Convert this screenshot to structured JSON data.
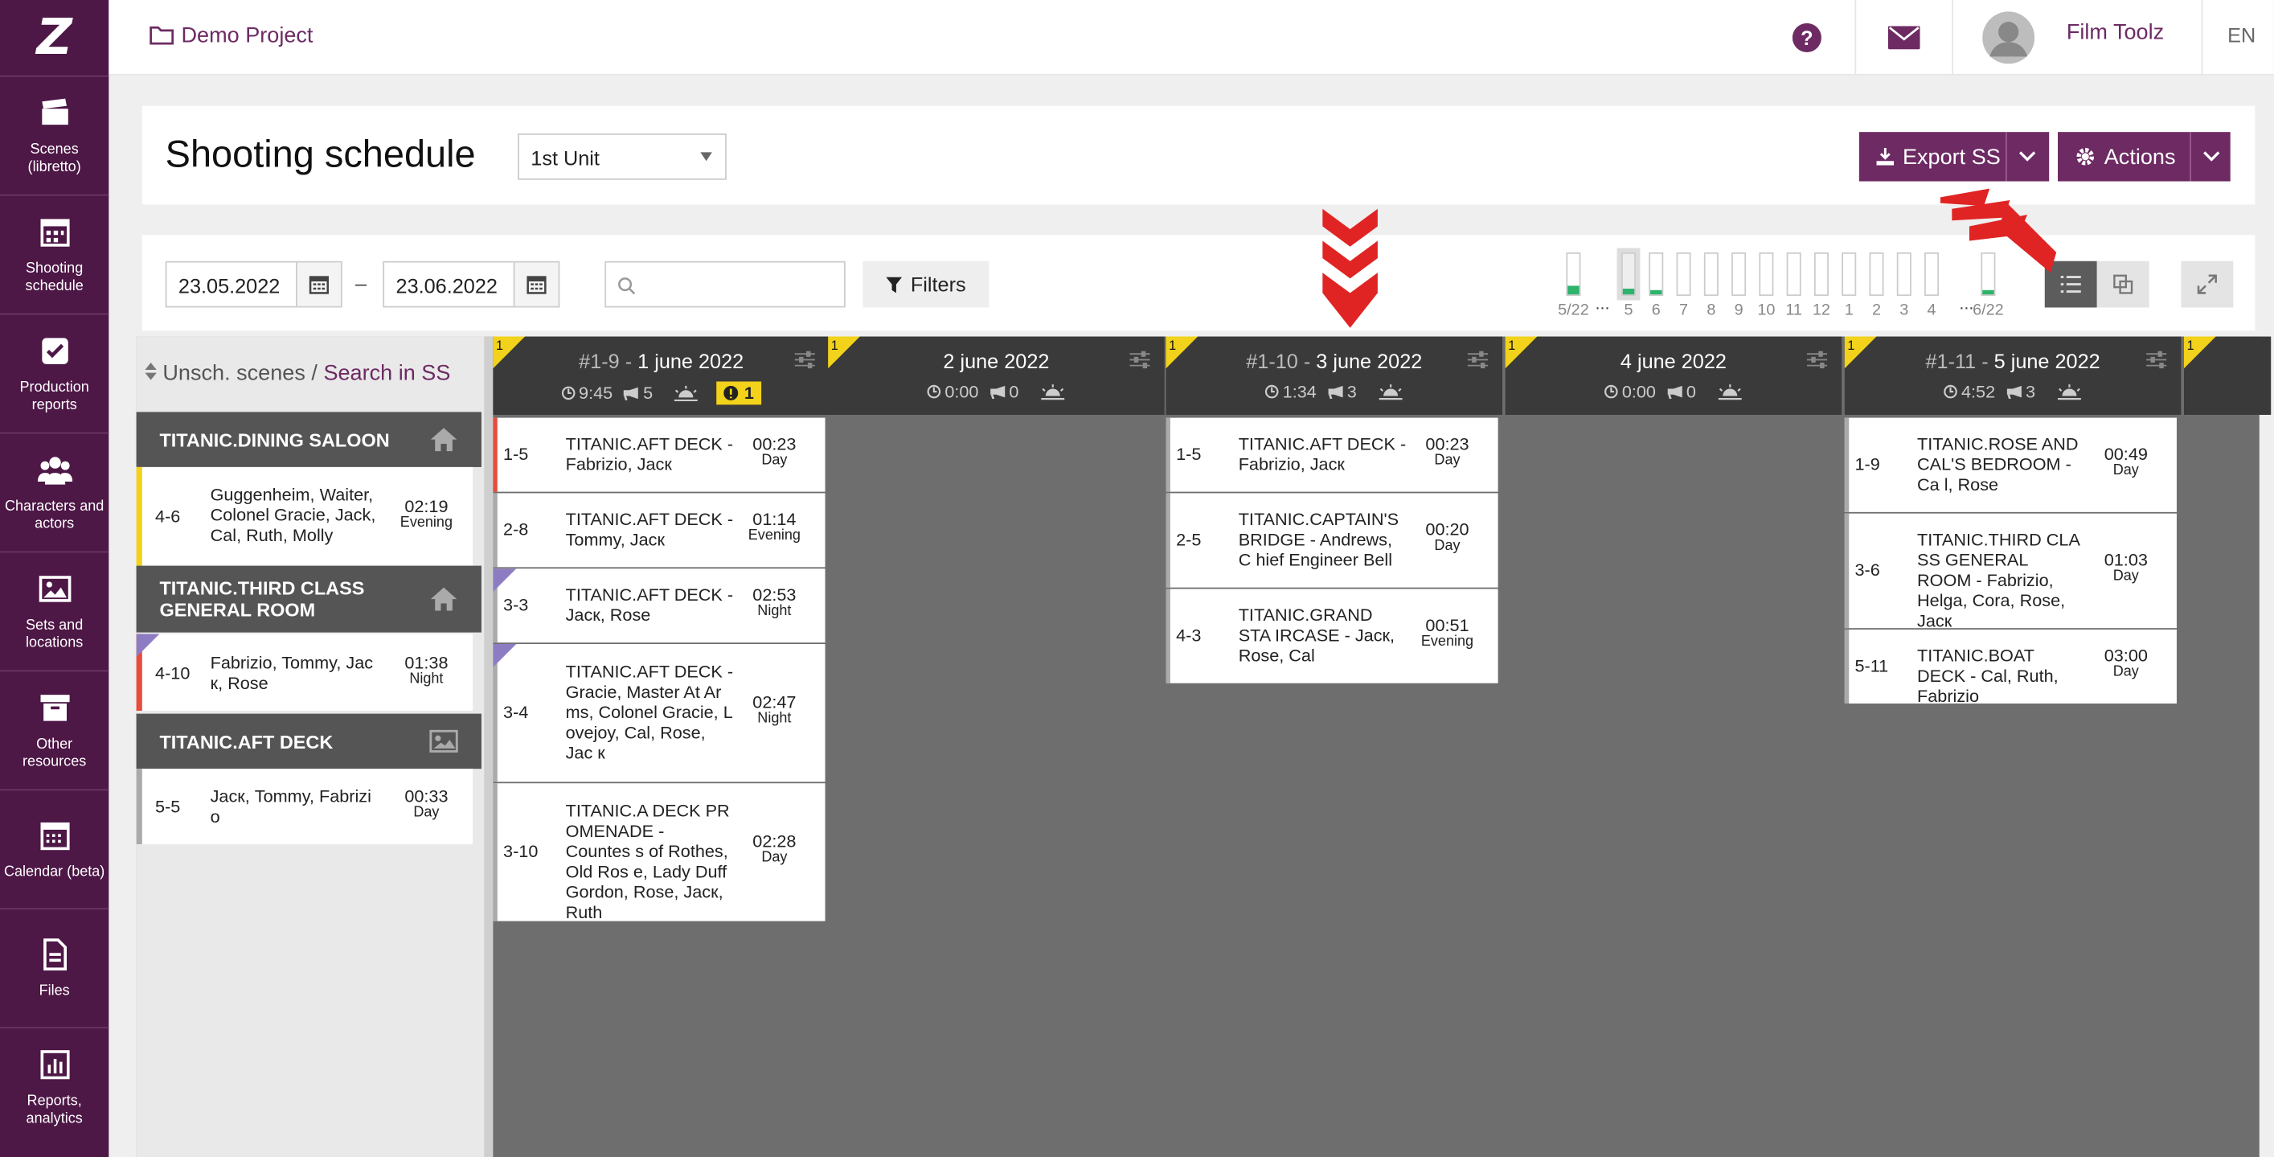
{
  "sidebar": {
    "items": [
      {
        "label": "Scenes (libretto)",
        "icon": "clapperboard-icon"
      },
      {
        "label": "Shooting schedule",
        "icon": "calendar-icon"
      },
      {
        "label": "Production reports",
        "icon": "checkbox-icon"
      },
      {
        "label": "Characters and actors",
        "icon": "users-icon"
      },
      {
        "label": "Sets and locations",
        "icon": "image-icon"
      },
      {
        "label": "Other resources",
        "icon": "archive-box-icon"
      },
      {
        "label": "Calendar (beta)",
        "icon": "calendar-grid-icon"
      },
      {
        "label": "Files",
        "icon": "file-icon"
      },
      {
        "label": "Reports, analytics",
        "icon": "bar-chart-icon"
      }
    ]
  },
  "topbar": {
    "project": "Demo Project",
    "user_name": "Film Toolz",
    "lang": "EN"
  },
  "header": {
    "title": "Shooting schedule",
    "unit": "1st Unit",
    "export_label": "Export SS",
    "actions_label": "Actions"
  },
  "toolbar": {
    "date_from": "23.05.2022",
    "date_to": "23.06.2022",
    "filters_label": "Filters",
    "bars": [
      {
        "label": "5/22",
        "fill": 0.2
      },
      {
        "label": "5",
        "fill": 0.15
      },
      {
        "label": "6",
        "fill": 0.12
      },
      {
        "label": "7",
        "fill": 0
      },
      {
        "label": "8",
        "fill": 0
      },
      {
        "label": "9",
        "fill": 0
      },
      {
        "label": "10",
        "fill": 0
      },
      {
        "label": "11",
        "fill": 0
      },
      {
        "label": "12",
        "fill": 0
      },
      {
        "label": "1",
        "fill": 0
      },
      {
        "label": "2",
        "fill": 0
      },
      {
        "label": "3",
        "fill": 0
      },
      {
        "label": "4",
        "fill": 0
      },
      {
        "label": "6/22",
        "fill": 0.12
      }
    ],
    "ellipsis": "..."
  },
  "left_panel": {
    "unsch_label": "Unsch. scenes",
    "slash": "/",
    "search_link": "Search in SS",
    "groups": [
      {
        "title": "TITANIC.DINING SALOON",
        "scenes": [
          {
            "num": "4-6",
            "desc": "Guggenheim, Waiter, Colonel Gracie, Jack, Cal, Ruth, Molly",
            "time": "02:19",
            "daypart": "Evening"
          }
        ]
      },
      {
        "title": "TITANIC.THIRD CLASS GENERAL ROOM",
        "scenes": [
          {
            "num": "4-10",
            "desc": "Fabrizio, Tommy, Jac к, Rose",
            "time": "01:38",
            "daypart": "Night"
          }
        ]
      },
      {
        "title": "TITANIC.AFT DECK",
        "scenes": [
          {
            "num": "5-5",
            "desc": "Jacк, Tommy, Fabrizi o",
            "time": "00:33",
            "daypart": "Day"
          }
        ]
      }
    ]
  },
  "days": [
    {
      "prefix": "#1-9 -",
      "date": "1 june 2022",
      "duration": "9:45",
      "scenes_count": "5",
      "warning": "1",
      "corner": "1",
      "scenes": [
        {
          "num": "1-5",
          "desc": "TITANIC.AFT DECK - Fabrizio, Jacк",
          "time": "00:23",
          "daypart": "Day"
        },
        {
          "num": "2-8",
          "desc": "TITANIC.AFT DECK - Tommy, Jacк",
          "time": "01:14",
          "daypart": "Evening"
        },
        {
          "num": "3-3",
          "desc": "TITANIC.AFT DECK - Jacк, Rose",
          "time": "02:53",
          "daypart": "Night"
        },
        {
          "num": "3-4",
          "desc": "TITANIC.AFT DECK - Gracie, Master At Ar ms, Colonel Gracie, L ovejoy, Cal, Rose, Jac к",
          "time": "02:47",
          "daypart": "Night"
        },
        {
          "num": "3-10",
          "desc": "TITANIC.A DECK PR OMENADE - Countes s of Rothes, Old Ros e, Lady Duff Gordon, Rose, Jacк, Ruth",
          "time": "02:28",
          "daypart": "Day"
        }
      ]
    },
    {
      "prefix": "",
      "date": "2 june 2022",
      "duration": "0:00",
      "scenes_count": "0",
      "warning": "",
      "corner": "1",
      "scenes": []
    },
    {
      "prefix": "#1-10 -",
      "date": "3 june 2022",
      "duration": "1:34",
      "scenes_count": "3",
      "warning": "",
      "corner": "1",
      "scenes": [
        {
          "num": "1-5",
          "desc": "TITANIC.AFT DECK - Fabrizio, Jacк",
          "time": "00:23",
          "daypart": "Day"
        },
        {
          "num": "2-5",
          "desc": "TITANIC.CAPTAIN'S BRIDGE - Andrews, C hief Engineer Bell",
          "time": "00:20",
          "daypart": "Day"
        },
        {
          "num": "4-3",
          "desc": "TITANIC.GRAND STA IRCASE - Jacк, Rose, Cal",
          "time": "00:51",
          "daypart": "Evening"
        }
      ]
    },
    {
      "prefix": "",
      "date": "4 june 2022",
      "duration": "0:00",
      "scenes_count": "0",
      "warning": "",
      "corner": "1",
      "scenes": []
    },
    {
      "prefix": "#1-11 -",
      "date": "5 june 2022",
      "duration": "4:52",
      "scenes_count": "3",
      "warning": "",
      "corner": "1",
      "scenes": [
        {
          "num": "1-9",
          "desc": "TITANIC.ROSE AND CAL'S BEDROOM - Ca l, Rose",
          "time": "00:49",
          "daypart": "Day"
        },
        {
          "num": "3-6",
          "desc": "TITANIC.THIRD CLA SS GENERAL ROOM - Fabrizio, Helga, Cora, Rose, Jacк",
          "time": "01:03",
          "daypart": "Day"
        },
        {
          "num": "5-11",
          "desc": "TITANIC.BOAT DECK - Cal, Ruth, Fabrizio",
          "time": "03:00",
          "daypart": "Day"
        }
      ]
    },
    {
      "prefix": "",
      "date": "",
      "duration": "",
      "scenes_count": "",
      "warning": "",
      "corner": "1",
      "scenes": []
    }
  ],
  "colors": {
    "brand": "#4d1746",
    "accent": "#6d2a63",
    "green": "#2db36b",
    "yellow": "#f2d21b",
    "red": "#e02424"
  }
}
